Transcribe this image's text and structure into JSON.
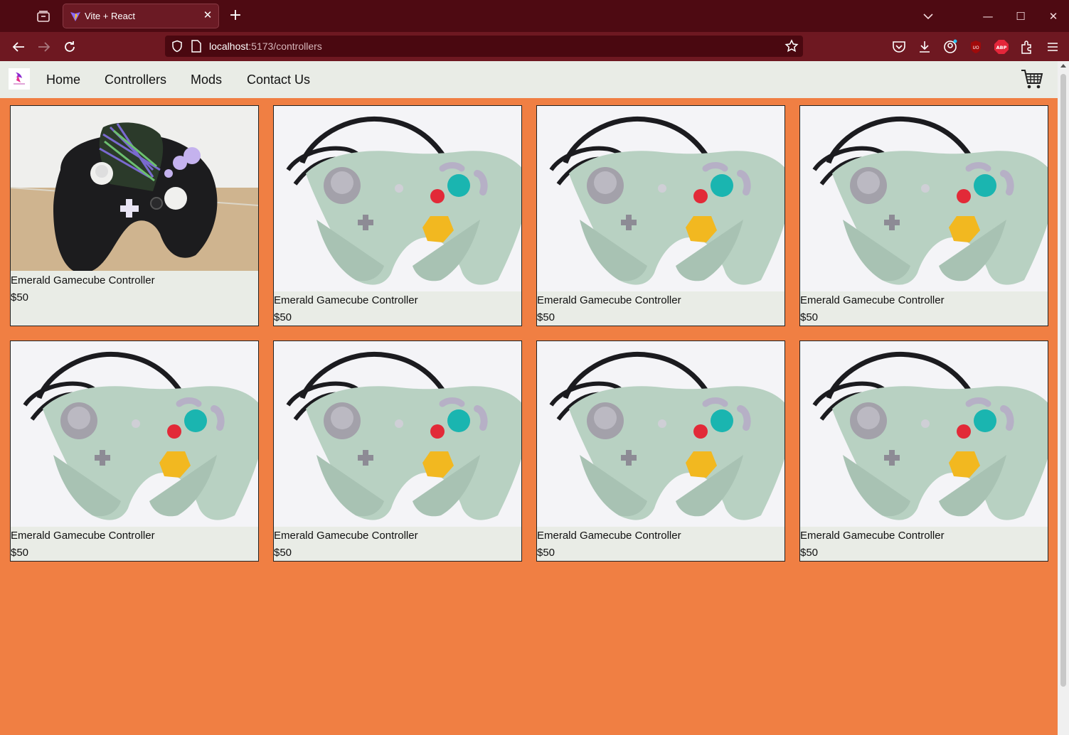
{
  "browser": {
    "tab_title": "Vite + React",
    "url_host": "localhost",
    "url_path": ":5173/controllers"
  },
  "nav": {
    "links": [
      "Home",
      "Controllers",
      "Mods",
      "Contact Us"
    ]
  },
  "products": [
    {
      "name": "Emerald Gamecube Controller",
      "price": "$50",
      "variant": "black"
    },
    {
      "name": "Emerald Gamecube Controller",
      "price": "$50",
      "variant": "mint"
    },
    {
      "name": "Emerald Gamecube Controller",
      "price": "$50",
      "variant": "mint"
    },
    {
      "name": "Emerald Gamecube Controller",
      "price": "$50",
      "variant": "mint"
    },
    {
      "name": "Emerald Gamecube Controller",
      "price": "$50",
      "variant": "mint"
    },
    {
      "name": "Emerald Gamecube Controller",
      "price": "$50",
      "variant": "mint"
    },
    {
      "name": "Emerald Gamecube Controller",
      "price": "$50",
      "variant": "mint"
    },
    {
      "name": "Emerald Gamecube Controller",
      "price": "$50",
      "variant": "mint"
    }
  ],
  "colors": {
    "page_bg": "#f07f43",
    "nav_bg": "#e9ece6",
    "browser_tabbar": "#4e0a12",
    "browser_navbar": "#6e1821"
  }
}
